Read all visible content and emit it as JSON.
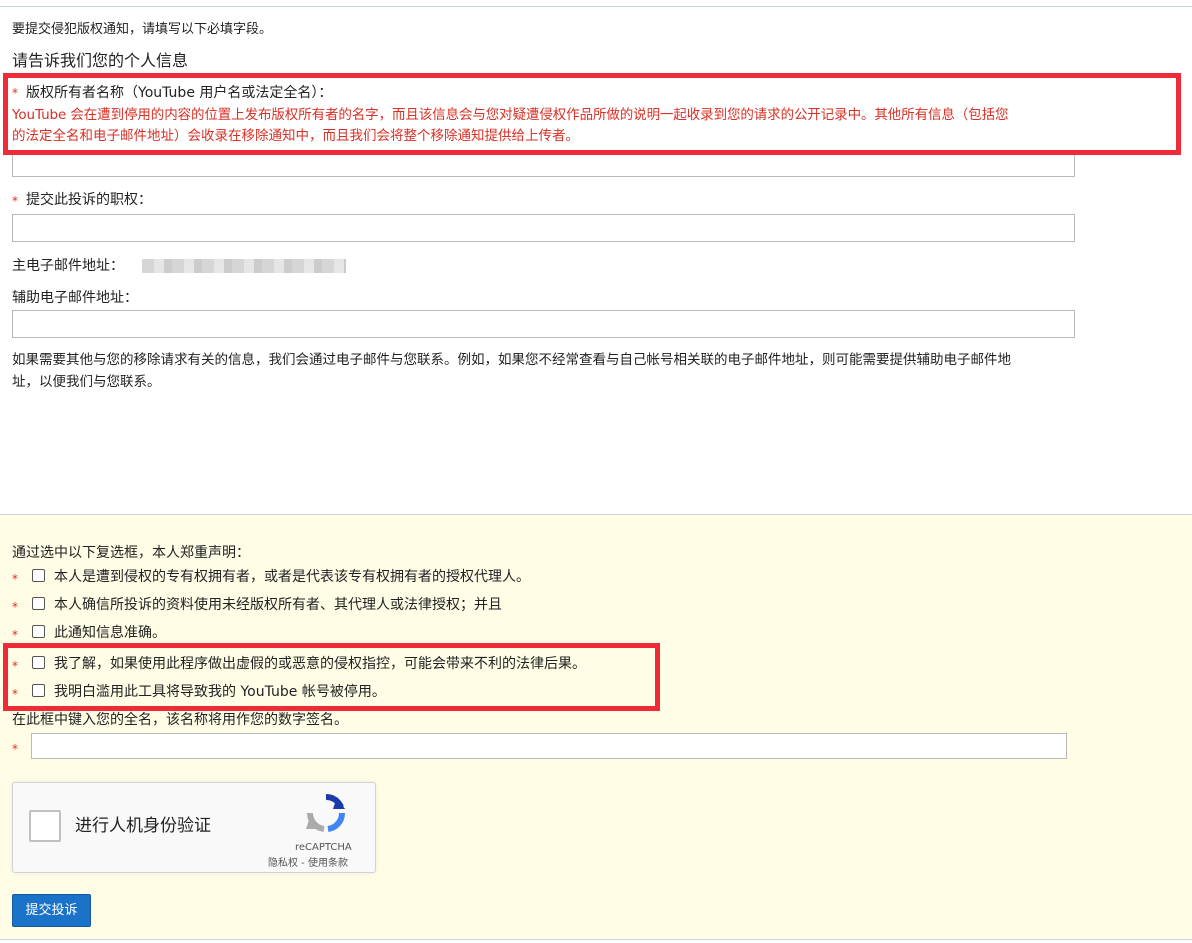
{
  "intro": "要提交侵犯版权通知，请填写以下必填字段。",
  "section_title": "请告诉我们您的个人信息",
  "required_mark": "*",
  "fields": {
    "owner_name_label": "版权所有者名称（YouTube 用户名或法定全名）：",
    "owner_name_help_line1": "YouTube 会在遭到停用的内容的位置上发布版权所有者的名字，而且该信息会与您对疑遭侵权作品所做的说明一起收录到您的请求的公开记录中。其他所有信息（包括您",
    "owner_name_help_line2": "的法定全名和电子邮件地址）会收录在移除通知中，而且我们会将整个移除通知提供给上传者。",
    "authority_label": "提交此投诉的职权：",
    "primary_email_label": "主电子邮件地址：",
    "secondary_email_label": "辅助电子邮件地址：",
    "contact_note_line1": "如果需要其他与您的移除请求有关的信息，我们会通过电子邮件与您联系。例如，如果您不经常查看与自己帐号相关联的电子邮件地址，则可能需要提供辅助电子邮件地",
    "contact_note_line2": "址，以便我们与您联系。"
  },
  "declaration": {
    "title": "通过选中以下复选框，本人郑重声明：",
    "items": [
      "本人是遭到侵权的专有权拥有者，或者是代表该专有权拥有者的授权代理人。",
      "本人确信所投诉的资料使用未经版权所有者、其代理人或法律授权；并且",
      "此通知信息准确。",
      "我了解，如果使用此程序做出虚假的或恶意的侵权指控，可能会带来不利的法律后果。",
      "我明白滥用此工具将导致我的 YouTube 帐号被停用。"
    ],
    "signature_label": "在此框中键入您的全名，该名称将用作您的数字签名。"
  },
  "captcha": {
    "label": "进行人机身份验证",
    "brand": "reCAPTCHA",
    "terms": "隐私权 - 使用条款"
  },
  "submit_label": "提交投诉",
  "colors": {
    "highlight_border": "#ef2b38",
    "required": "#d93025",
    "declaration_bg": "#fffde6",
    "submit_bg": "#1a73c8"
  }
}
